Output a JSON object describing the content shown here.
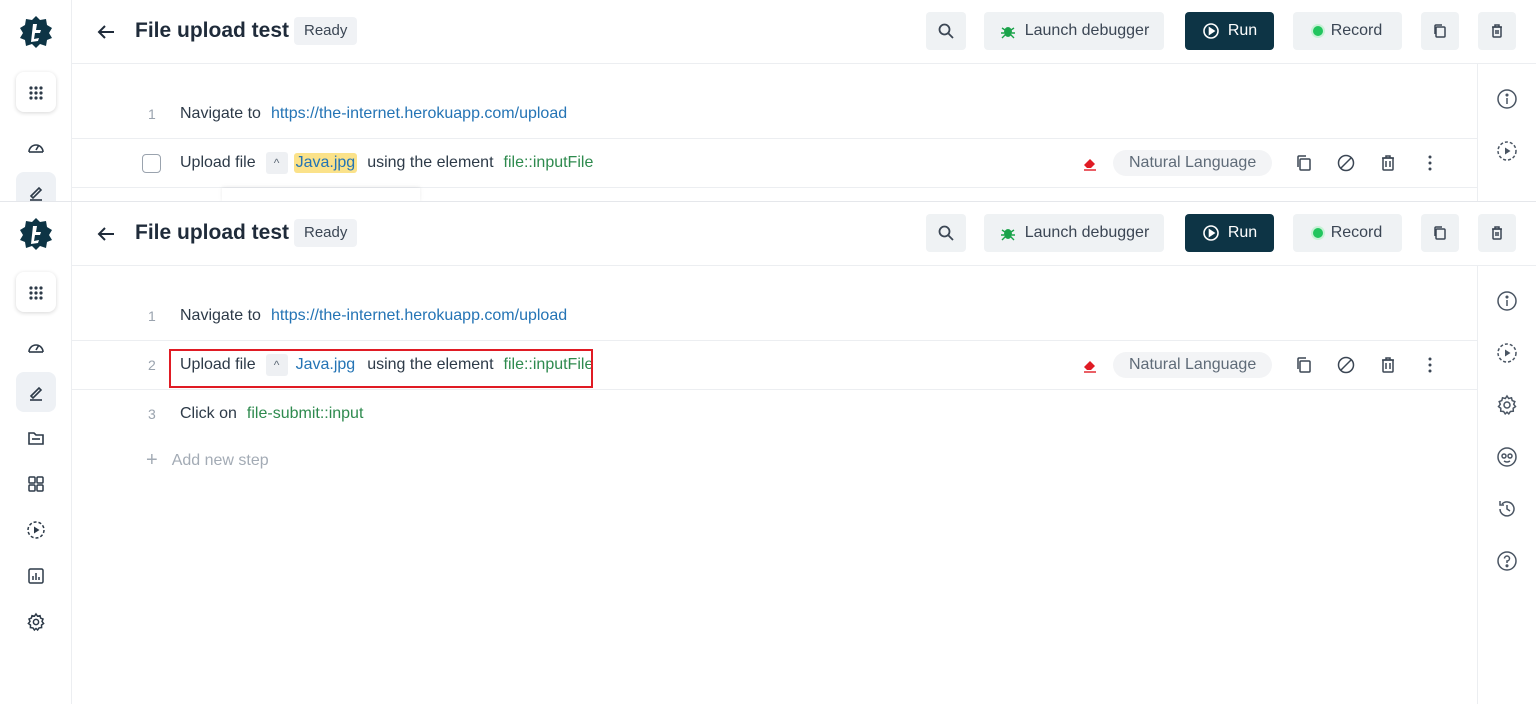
{
  "app": {
    "title": "File upload test",
    "status": "Ready",
    "colors": {
      "primary_dark": "#0d3445",
      "url_blue": "#2474b5",
      "element_green": "#2e8a4e",
      "highlight_red": "#e01b24",
      "value_highlight": "#fbe28a"
    }
  },
  "header": {
    "debugger_label": "Launch debugger",
    "run_label": "Run",
    "record_label": "Record"
  },
  "steps": [
    {
      "number": "1",
      "keyword": "Navigate to",
      "url": "https://the-internet.herokuapp.com/upload"
    },
    {
      "number": "2",
      "keyword": "Upload file",
      "value": "Java.jpg",
      "connector": "using the element",
      "element": "file::inputFile",
      "mode": "Natural Language"
    },
    {
      "number": "3",
      "keyword": "Click on",
      "element": "file-submit::input"
    }
  ],
  "add_step_label": "Add new step",
  "caret_glyph": "^",
  "icons": {
    "left_rail": [
      "apps-grid-icon",
      "dashboard-icon",
      "edit-icon",
      "folder-icon",
      "modules-icon",
      "play-circle-icon",
      "report-icon",
      "settings-icon"
    ],
    "right_rail": [
      "info-icon",
      "play-circle-icon",
      "settings-icon",
      "ai-face-icon",
      "history-icon",
      "help-icon"
    ]
  }
}
